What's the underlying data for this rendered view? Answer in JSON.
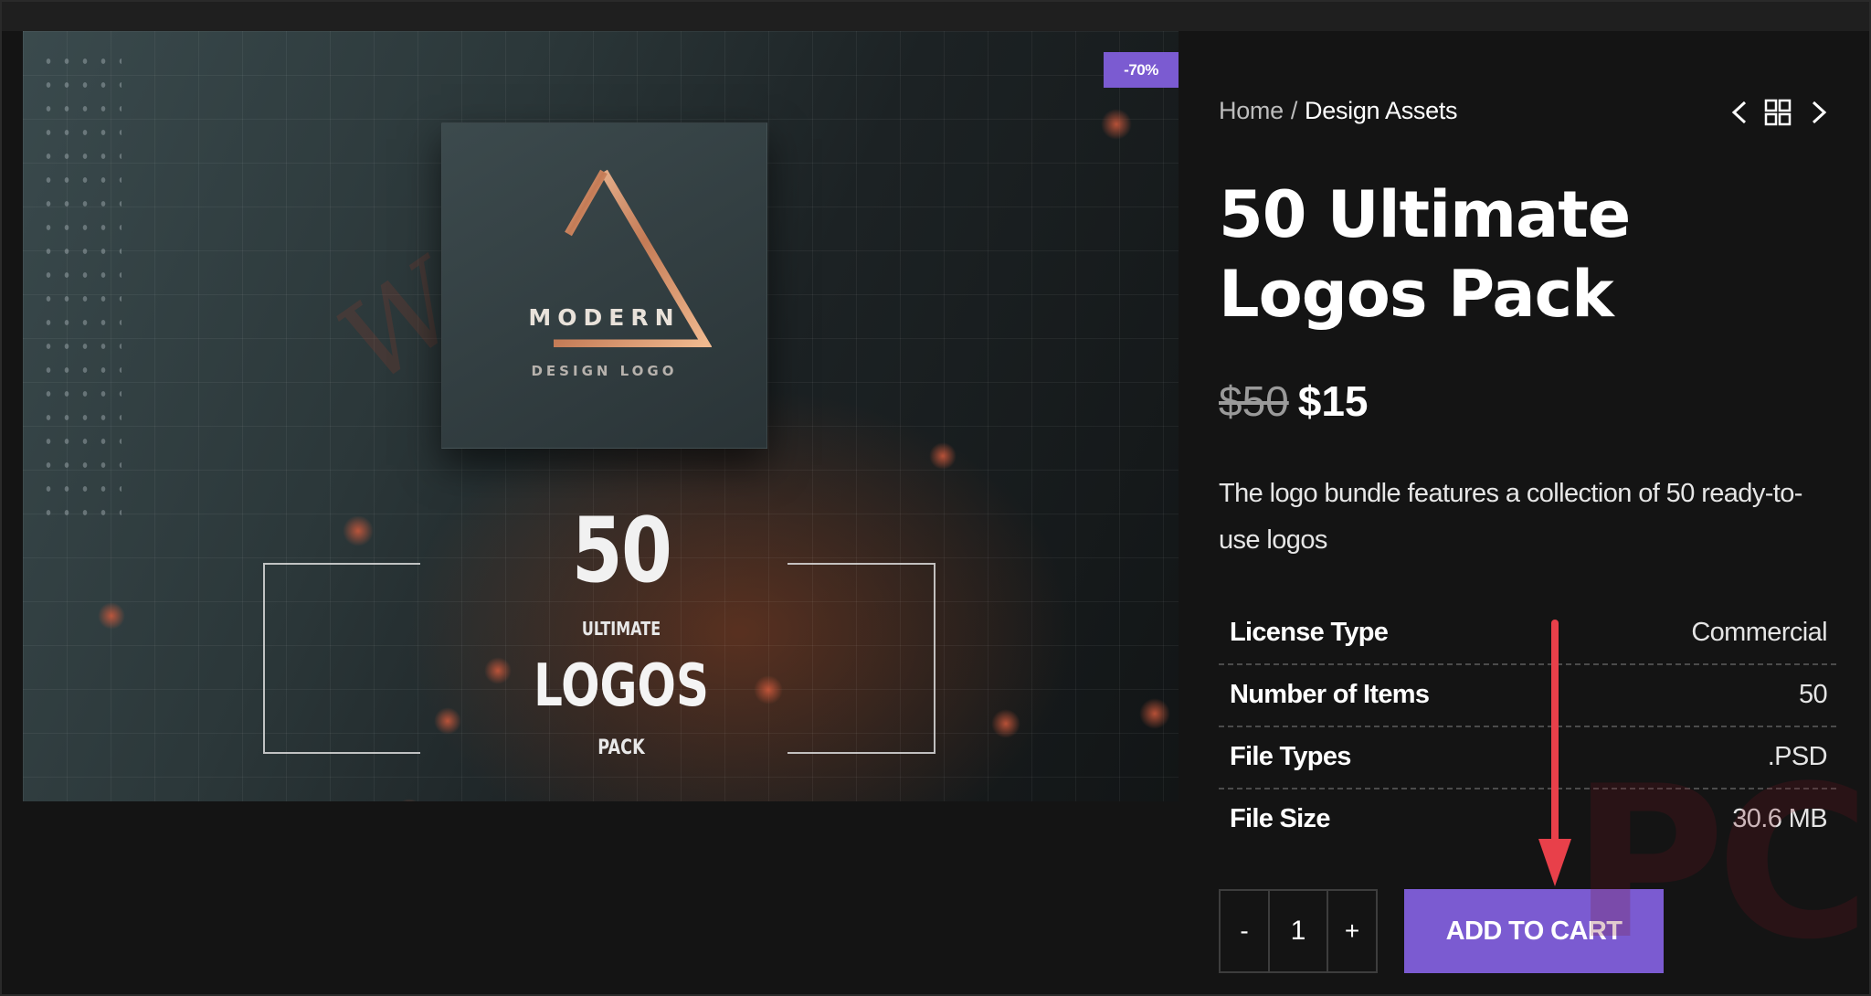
{
  "product_image": {
    "discount_badge": "-70%",
    "logo_title": "MODERN",
    "logo_subtitle": "DESIGN LOGO",
    "pack_number": "50",
    "pack_ultimate": "ULTIMATE",
    "pack_logos": "LOGOS",
    "pack_pack": "PACK"
  },
  "breadcrumb": {
    "home": "Home",
    "separator": "/",
    "current": "Design Assets"
  },
  "nav": {
    "prev_icon": "chevron-left-icon",
    "grid_icon": "grid-icon",
    "next_icon": "chevron-right-icon"
  },
  "product": {
    "title": "50 Ultimate Logos Pack",
    "old_price": "$50",
    "new_price": "$15",
    "description": "The logo bundle features a collection of 50 ready-to-use logos"
  },
  "specs": [
    {
      "label": "License Type",
      "value": "Commercial"
    },
    {
      "label": "Number of Items",
      "value": "50"
    },
    {
      "label": "File Types",
      "value": ".PSD"
    },
    {
      "label": "File Size",
      "value": "30.6 MB"
    }
  ],
  "cart": {
    "minus": "-",
    "quantity": "1",
    "plus": "+",
    "add_to_cart": "ADD TO CART"
  },
  "colors": {
    "accent": "#7b5bd1",
    "background": "#141414",
    "annotation": "#e8404a"
  }
}
